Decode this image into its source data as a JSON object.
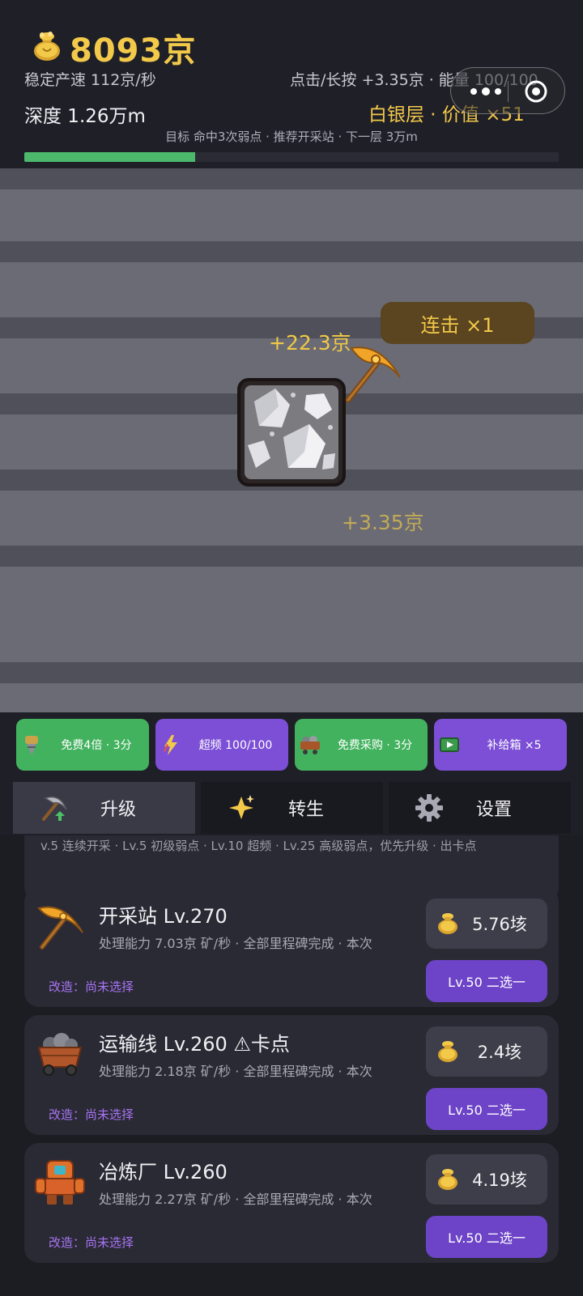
{
  "header": {
    "gold_total": "8093京",
    "stable_rate": "稳定产速 112京/秒",
    "tap_info": "点击/长按 +3.35京 · 能量 100/100",
    "depth": "深度 1.26万m",
    "layer": "白银层 · 价值 ×51",
    "goal": "目标 命中3次弱点 · 推荐开采站 · 下一层 3万m",
    "depth_progress": 0.32,
    "icons": {
      "coin": "gold-bag-icon",
      "menu": "more-dots-icon",
      "close": "target-close-icon"
    }
  },
  "mine": {
    "combo": "连击 ×1",
    "gain_big": "+22.3京",
    "gain_small": "+3.35京",
    "icons": {
      "ore": "silver-ore-block-icon",
      "tool": "golden-pickaxe-icon"
    }
  },
  "boosts": [
    {
      "label": "免费4倍 · 3分",
      "icon": "drill-icon",
      "color": "#43b25f"
    },
    {
      "label": "超频 100/100",
      "icon": "lightning-icon",
      "color": "#7c4fd6"
    },
    {
      "label": "免费采购 · 3分",
      "icon": "minecart-icon",
      "color": "#43b25f"
    },
    {
      "label": "补给箱 ×5",
      "icon": "video-icon",
      "color": "#7c4fd6"
    }
  ],
  "tabs": [
    {
      "label": "升级",
      "icon": "pickaxe-upgrade-icon",
      "active": true
    },
    {
      "label": "转生",
      "icon": "sparkle-icon",
      "active": false
    },
    {
      "label": "设置",
      "icon": "gear-icon",
      "active": false
    }
  ],
  "list": {
    "previous_hint": "v.5 连续开采 · Lv.5 初级弱点 · Lv.10 超频 · Lv.25 高级弱点，优先升级 · 出卡点",
    "items": [
      {
        "title": "开采站 Lv.270",
        "desc": "处理能力 7.03京 矿/秒 · 全部里程碑完成 · 本次",
        "mod": "改造：尚未选择",
        "cost": "5.76垓",
        "choose": "Lv.50 二选一",
        "icon": "pickaxe-icon"
      },
      {
        "title": "运输线 Lv.260 ⚠卡点",
        "desc": "处理能力 2.18京 矿/秒 · 全部里程碑完成 · 本次",
        "mod": "改造：尚未选择",
        "cost": "2.4垓",
        "choose": "Lv.50 二选一",
        "icon": "minecart-icon"
      },
      {
        "title": "冶炼厂 Lv.260",
        "desc": "处理能力 2.27京 矿/秒 · 全部里程碑完成 · 本次",
        "mod": "改造：尚未选择",
        "cost": "4.19垓",
        "choose": "Lv.50 二选一",
        "icon": "robot-icon"
      }
    ]
  }
}
